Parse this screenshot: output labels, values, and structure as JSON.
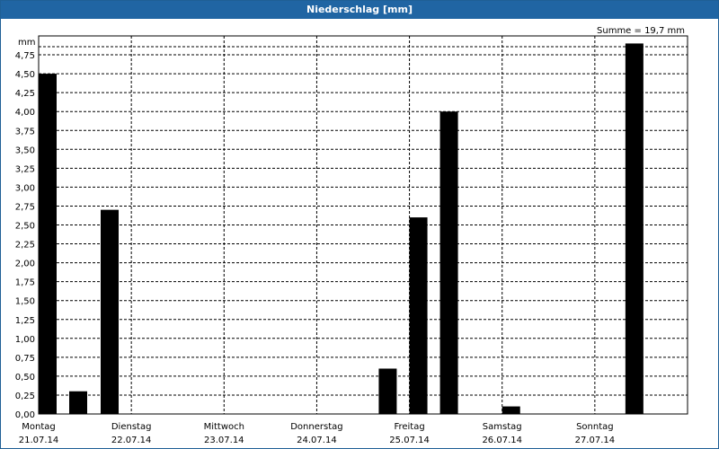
{
  "title": "Niederschlag [mm]",
  "summary": "Summe = 19,7 mm",
  "colors": {
    "titlebar": "#2065a3",
    "bar": "#000000",
    "grid": "#000000"
  },
  "chart_data": {
    "type": "bar",
    "title": "Niederschlag [mm]",
    "ylabel": "mm",
    "ylim": [
      0,
      5
    ],
    "grid": true,
    "yticks": [
      "0,00",
      "0,25",
      "0,50",
      "0,75",
      "1,00",
      "1,25",
      "1,50",
      "1,75",
      "2,00",
      "2,25",
      "2,50",
      "2,75",
      "3,00",
      "3,25",
      "3,50",
      "3,75",
      "4,00",
      "4,25",
      "4,50",
      "4,75"
    ],
    "days": [
      {
        "name": "Montag",
        "date": "21.07.14"
      },
      {
        "name": "Dienstag",
        "date": "22.07.14"
      },
      {
        "name": "Mittwoch",
        "date": "23.07.14"
      },
      {
        "name": "Donnerstag",
        "date": "24.07.14"
      },
      {
        "name": "Freitag",
        "date": "25.07.14"
      },
      {
        "name": "Samstag",
        "date": "26.07.14"
      },
      {
        "name": "Sonntag",
        "date": "27.07.14"
      }
    ],
    "bars": [
      {
        "day": 0,
        "slot": 0,
        "value": 4.5
      },
      {
        "day": 0,
        "slot": 1,
        "value": 0.3
      },
      {
        "day": 0,
        "slot": 2,
        "value": 2.7
      },
      {
        "day": 3,
        "slot": 2,
        "value": 0.6
      },
      {
        "day": 4,
        "slot": 0,
        "value": 2.6
      },
      {
        "day": 4,
        "slot": 1,
        "value": 4.0
      },
      {
        "day": 5,
        "slot": 0,
        "value": 0.1
      },
      {
        "day": 6,
        "slot": 1,
        "value": 4.9
      }
    ]
  }
}
